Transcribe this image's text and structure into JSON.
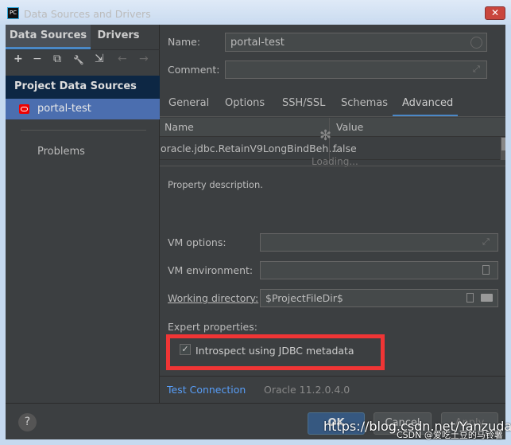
{
  "window": {
    "title": "Data Sources and Drivers",
    "close": "✕",
    "app_icon": "PC"
  },
  "left": {
    "tabs": [
      "Data Sources",
      "Drivers"
    ],
    "toolbar": [
      "+",
      "−",
      "⧉",
      "🔧",
      "⇲",
      "←",
      "→"
    ],
    "section": "Project Data Sources",
    "selected": "portal-test",
    "problems": "Problems"
  },
  "form": {
    "name_label": "Name:",
    "name_value": "portal-test",
    "comment_label": "Comment:",
    "comment_value": ""
  },
  "tabs": [
    "General",
    "Options",
    "SSH/SSL",
    "Schemas",
    "Advanced"
  ],
  "active_tab": "Advanced",
  "table": {
    "headers": [
      "Name",
      "Value"
    ],
    "rows": [
      {
        "name": "oracle.jdbc.RetainV9LongBindBeh...",
        "value": "false"
      }
    ],
    "loading": "Loading..."
  },
  "property_description": "Property description.",
  "vm": {
    "options_label": "VM options:",
    "options_value": "",
    "env_label": "VM environment:",
    "env_value": "",
    "wd_label": "Working directory:",
    "wd_value": "$ProjectFileDir$"
  },
  "expert": {
    "label": "Expert properties:",
    "introspect_label": "Introspect using JDBC metadata",
    "introspect_checked": true
  },
  "test_connection": "Test Connection",
  "driver_version": "Oracle 11.2.0.4.0",
  "footer": {
    "help": "?",
    "ok": "OK",
    "cancel": "Cancel",
    "apply": "Apply"
  },
  "watermark": {
    "url": "https://blog.csdn.net/Yanzudada",
    "author": "CSDN @爱吃土豆的马铃薯"
  },
  "colors": {
    "accent": "#4a88c7",
    "highlight": "#f03535",
    "link": "#589df6"
  }
}
